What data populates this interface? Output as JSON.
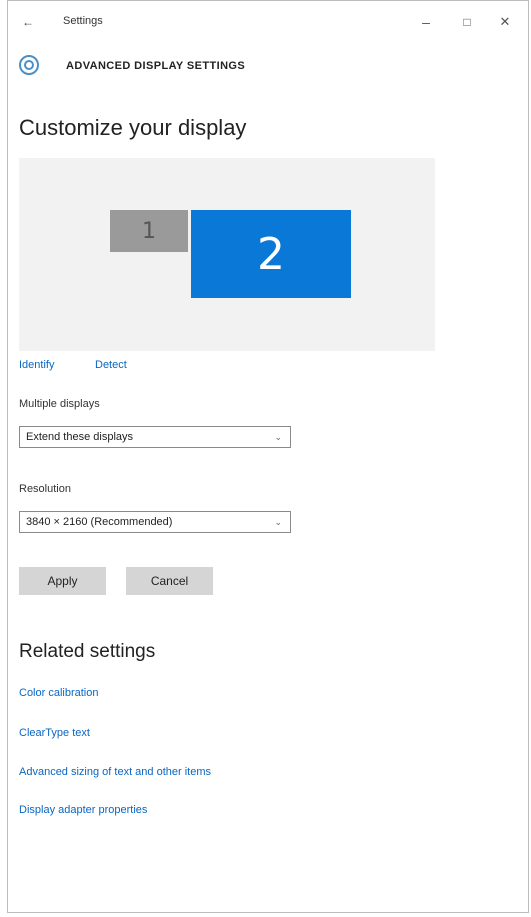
{
  "titlebar": {
    "back_glyph": "←",
    "title": "Settings",
    "minimize_glyph": "–",
    "maximize_glyph": "□",
    "close_glyph": "✕"
  },
  "header": {
    "icon": "gear-icon",
    "title": "ADVANCED DISPLAY SETTINGS"
  },
  "page": {
    "title": "Customize your display"
  },
  "displays": {
    "monitor_1_label": "1",
    "monitor_2_label": "2",
    "selected_color": "#0a78d7",
    "unselected_color": "#9a9a9a",
    "identify_label": "Identify",
    "detect_label": "Detect"
  },
  "multiple_displays": {
    "label": "Multiple displays",
    "value": "Extend these displays"
  },
  "resolution": {
    "label": "Resolution",
    "value": "3840 × 2160 (Recommended)"
  },
  "actions": {
    "apply_label": "Apply",
    "cancel_label": "Cancel"
  },
  "related": {
    "title": "Related settings",
    "links": [
      "Color calibration",
      "ClearType text",
      "Advanced sizing of text and other items",
      "Display adapter properties"
    ]
  },
  "colors": {
    "accent": "#0a78d7",
    "link": "#0a66c2"
  }
}
